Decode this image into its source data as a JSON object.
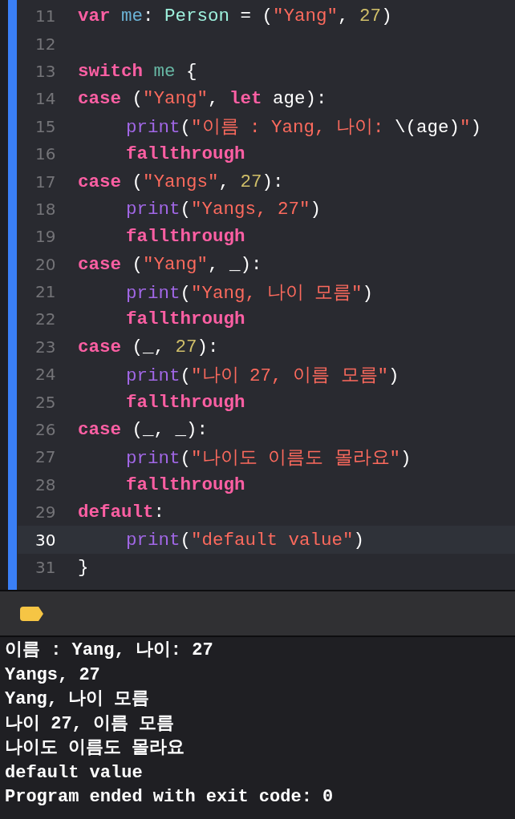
{
  "editor": {
    "lines": [
      {
        "number": "11",
        "current": false,
        "tokens": [
          {
            "kind": "keyword",
            "text": "var"
          },
          {
            "kind": "variable",
            "text": " me"
          },
          {
            "kind": "plain",
            "text": ": "
          },
          {
            "kind": "type",
            "text": "Person"
          },
          {
            "kind": "plain",
            "text": " = ("
          },
          {
            "kind": "string",
            "text": "\"Yang\""
          },
          {
            "kind": "plain",
            "text": ", "
          },
          {
            "kind": "number",
            "text": "27"
          },
          {
            "kind": "plain",
            "text": ")"
          }
        ]
      },
      {
        "number": "12",
        "current": false
      },
      {
        "number": "13",
        "current": false,
        "tokens": [
          {
            "kind": "keyword",
            "text": "switch"
          },
          {
            "kind": "reference",
            "text": " me"
          },
          {
            "kind": "plain",
            "text": " {"
          }
        ]
      },
      {
        "number": "14",
        "current": false,
        "tokens": [
          {
            "kind": "keyword",
            "text": "case"
          },
          {
            "kind": "plain",
            "text": " ("
          },
          {
            "kind": "string",
            "text": "\"Yang\""
          },
          {
            "kind": "plain",
            "text": ", "
          },
          {
            "kind": "keyword",
            "text": "let"
          },
          {
            "kind": "plain",
            "text": " age):"
          }
        ],
        "children": [
          {
            "number": "15",
            "current": false,
            "tokens": [
              {
                "kind": "function",
                "text": "print"
              },
              {
                "kind": "plain",
                "text": "("
              },
              {
                "kind": "string",
                "text": "\"이름 : Yang, 나이: "
              },
              {
                "kind": "plain",
                "text": "\\(age)"
              },
              {
                "kind": "string",
                "text": "\""
              },
              {
                "kind": "plain",
                "text": ")"
              }
            ]
          },
          {
            "number": "16",
            "current": false,
            "tokens": [
              {
                "kind": "keyword",
                "text": "fallthrough"
              }
            ]
          }
        ]
      },
      {
        "number": "17",
        "current": false,
        "tokens": [
          {
            "kind": "keyword",
            "text": "case"
          },
          {
            "kind": "plain",
            "text": " ("
          },
          {
            "kind": "string",
            "text": "\"Yangs\""
          },
          {
            "kind": "plain",
            "text": ", "
          },
          {
            "kind": "number",
            "text": "27"
          },
          {
            "kind": "plain",
            "text": "):"
          }
        ],
        "children": [
          {
            "number": "18",
            "current": false,
            "tokens": [
              {
                "kind": "function",
                "text": "print"
              },
              {
                "kind": "plain",
                "text": "("
              },
              {
                "kind": "string",
                "text": "\"Yangs, 27\""
              },
              {
                "kind": "plain",
                "text": ")"
              }
            ]
          },
          {
            "number": "19",
            "current": false,
            "tokens": [
              {
                "kind": "keyword",
                "text": "fallthrough"
              }
            ]
          }
        ]
      },
      {
        "number": "20",
        "current": false,
        "tokens": [
          {
            "kind": "keyword",
            "text": "case"
          },
          {
            "kind": "plain",
            "text": " ("
          },
          {
            "kind": "string",
            "text": "\"Yang\""
          },
          {
            "kind": "plain",
            "text": ", _):"
          }
        ],
        "children": [
          {
            "number": "21",
            "current": false,
            "tokens": [
              {
                "kind": "function",
                "text": "print"
              },
              {
                "kind": "plain",
                "text": "("
              },
              {
                "kind": "string",
                "text": "\"Yang, 나이 모름\""
              },
              {
                "kind": "plain",
                "text": ")"
              }
            ]
          },
          {
            "number": "22",
            "current": false,
            "tokens": [
              {
                "kind": "keyword",
                "text": "fallthrough"
              }
            ]
          }
        ]
      },
      {
        "number": "23",
        "current": false,
        "tokens": [
          {
            "kind": "keyword",
            "text": "case"
          },
          {
            "kind": "plain",
            "text": " (_, "
          },
          {
            "kind": "number",
            "text": "27"
          },
          {
            "kind": "plain",
            "text": "):"
          }
        ],
        "children": [
          {
            "number": "24",
            "current": false,
            "tokens": [
              {
                "kind": "function",
                "text": "print"
              },
              {
                "kind": "plain",
                "text": "("
              },
              {
                "kind": "string",
                "text": "\"나이 27, 이름 모름\""
              },
              {
                "kind": "plain",
                "text": ")"
              }
            ]
          },
          {
            "number": "25",
            "current": false,
            "tokens": [
              {
                "kind": "keyword",
                "text": "fallthrough"
              }
            ]
          }
        ]
      },
      {
        "number": "26",
        "current": false,
        "tokens": [
          {
            "kind": "keyword",
            "text": "case"
          },
          {
            "kind": "plain",
            "text": " (_, _):"
          }
        ],
        "children": [
          {
            "number": "27",
            "current": false,
            "tokens": [
              {
                "kind": "function",
                "text": "print"
              },
              {
                "kind": "plain",
                "text": "("
              },
              {
                "kind": "string",
                "text": "\"나이도 이름도 몰라요\""
              },
              {
                "kind": "plain",
                "text": ")"
              }
            ]
          },
          {
            "number": "28",
            "current": false,
            "tokens": [
              {
                "kind": "keyword",
                "text": "fallthrough"
              }
            ]
          }
        ]
      },
      {
        "number": "29",
        "current": false,
        "tokens": [
          {
            "kind": "keyword",
            "text": "default"
          },
          {
            "kind": "plain",
            "text": ":"
          }
        ],
        "children": [
          {
            "number": "30",
            "current": true,
            "tokens": [
              {
                "kind": "function",
                "text": "print"
              },
              {
                "kind": "plain",
                "text": "("
              },
              {
                "kind": "string",
                "text": "\"default value\""
              },
              {
                "kind": "plain",
                "text": ")"
              }
            ]
          }
        ]
      },
      {
        "number": "31",
        "current": false,
        "tokens": [
          {
            "kind": "plain",
            "text": "}"
          }
        ]
      }
    ]
  },
  "console": {
    "output": [
      "이름 : Yang, 나이: 27",
      "Yangs, 27",
      "Yang, 나이 모름",
      "나이 27, 이름 모름",
      "나이도 이름도 몰라요",
      "default value",
      "Program ended with exit code: 0"
    ]
  }
}
